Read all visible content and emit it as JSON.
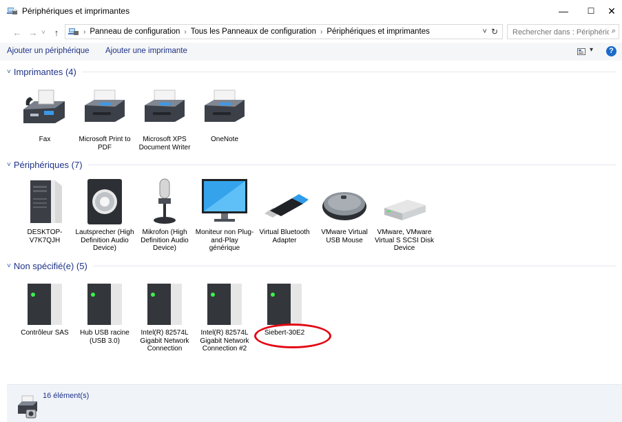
{
  "window": {
    "title": "Périphériques et imprimantes"
  },
  "controls": {
    "minimize": "—",
    "maximize": "☐",
    "close": "✕"
  },
  "nav": {
    "back": "←",
    "forward": "→",
    "recent": "˅",
    "up": "↑"
  },
  "address": {
    "crumbs": [
      "Panneau de configuration",
      "Tous les Panneaux de configuration",
      "Périphériques et imprimantes"
    ],
    "separator": "›",
    "dropdown": "˅",
    "refresh": "↻"
  },
  "search": {
    "placeholder": "Rechercher dans : Périphériqu...",
    "icon": "⌕"
  },
  "commandbar": {
    "add_device": "Ajouter un périphérique",
    "add_printer": "Ajouter une imprimante",
    "view_caret": "▾",
    "help": "?"
  },
  "groups": [
    {
      "name": "Imprimantes (4)",
      "items": [
        {
          "label": "Fax",
          "icon": "fax-icon"
        },
        {
          "label": "Microsoft Print to PDF",
          "icon": "printer-icon"
        },
        {
          "label": "Microsoft XPS Document Writer",
          "icon": "printer-icon"
        },
        {
          "label": "OneNote",
          "icon": "printer-icon"
        }
      ]
    },
    {
      "name": "Périphériques (7)",
      "items": [
        {
          "label": "DESKTOP-V7K7QJH",
          "icon": "computer-tower-icon"
        },
        {
          "label": "Lautsprecher (High Definition Audio Device)",
          "icon": "speaker-icon"
        },
        {
          "label": "Mikrofon (High Definition Audio Device)",
          "icon": "microphone-icon"
        },
        {
          "label": "Moniteur non Plug-and-Play générique",
          "icon": "monitor-icon"
        },
        {
          "label": "Virtual Bluetooth Adapter",
          "icon": "usb-dongle-icon"
        },
        {
          "label": "VMware Virtual USB Mouse",
          "icon": "mouse-icon"
        },
        {
          "label": "VMware, VMware Virtual S SCSI Disk Device",
          "icon": "disk-drive-icon"
        }
      ]
    },
    {
      "name": "Non spécifié(e) (5)",
      "items": [
        {
          "label": "Contrôleur SAS",
          "icon": "generic-device-icon"
        },
        {
          "label": "Hub USB racine (USB 3.0)",
          "icon": "generic-device-icon"
        },
        {
          "label": "Intel(R) 82574L Gigabit Network Connection",
          "icon": "generic-device-icon"
        },
        {
          "label": "Intel(R) 82574L Gigabit Network Connection #2",
          "icon": "generic-device-icon"
        },
        {
          "label": "Siebert-30E2",
          "icon": "generic-device-icon"
        }
      ]
    }
  ],
  "group_chevron": "˅",
  "details": {
    "count": "16 élément(s)"
  },
  "colors": {
    "link": "#1e3287",
    "annotation": "#e30613",
    "details_bg": "#f0f4f9"
  }
}
